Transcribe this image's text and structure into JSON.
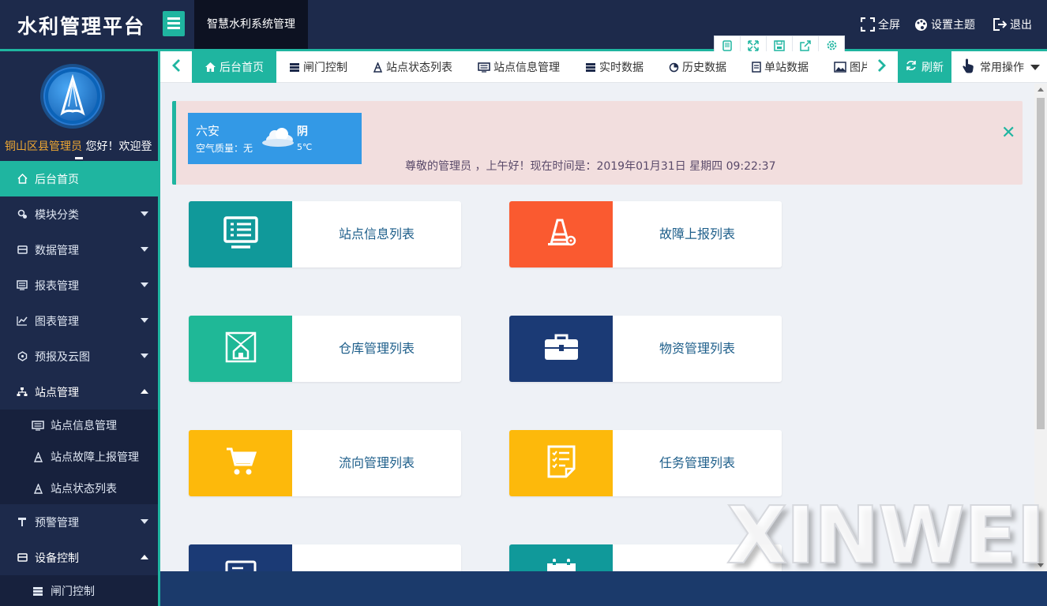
{
  "header": {
    "logo": "水利管理平台",
    "system_tab": "智慧水利系统管理",
    "fullscreen": "全屏",
    "theme": "设置主题",
    "logout": "退出"
  },
  "sidebar": {
    "user": "铜山区县管理员",
    "welcome": " 您好！欢迎登",
    "items": [
      {
        "label": "后台首页",
        "icon": "home-icon"
      },
      {
        "label": "模块分类",
        "icon": "module-icon"
      },
      {
        "label": "数据管理",
        "icon": "database-icon"
      },
      {
        "label": "报表管理",
        "icon": "report-icon"
      },
      {
        "label": "图表管理",
        "icon": "line-chart-icon"
      },
      {
        "label": "预报及云图",
        "icon": "cloud-icon"
      },
      {
        "label": "站点管理",
        "icon": "sitemap-icon"
      },
      {
        "label": "预警管理",
        "icon": "alarm-icon"
      },
      {
        "label": "设备控制",
        "icon": "device-icon"
      }
    ],
    "site_sub": [
      "站点信息管理",
      "站点故障上报管理",
      "站点状态列表"
    ],
    "device_sub": [
      "闸门控制"
    ]
  },
  "tabs": {
    "items": [
      "后台首页",
      "闸门控制",
      "站点状态列表",
      "站点信息管理",
      "实时数据",
      "历史数据",
      "单站数据",
      "图片管理"
    ],
    "refresh": "刷新",
    "common_ops": "常用操作"
  },
  "weather": {
    "city": "六安",
    "air_quality": "空气质量：无",
    "condition": "阴",
    "temperature": "5℃"
  },
  "notice": {
    "message": "尊敬的管理员 ，上午好！现在时间是：2019年01月31日 星期四 09:22:37",
    "close": "✕"
  },
  "cards": [
    {
      "label": "站点信息列表",
      "color": "#10999a",
      "icon": "monitor-list-icon"
    },
    {
      "label": "故障上报列表",
      "color": "#fa5a30",
      "icon": "cone-gear-icon"
    },
    {
      "label": "仓库管理列表",
      "color": "#1fb897",
      "icon": "warehouse-icon"
    },
    {
      "label": "物资管理列表",
      "color": "#1b3a75",
      "icon": "toolbox-icon"
    },
    {
      "label": "流向管理列表",
      "color": "#fdb90b",
      "icon": "cart-icon"
    },
    {
      "label": "任务管理列表",
      "color": "#fdb90b",
      "icon": "task-list-icon"
    },
    {
      "label": "",
      "color": "#1b3a75",
      "icon": "card-icon"
    },
    {
      "label": "",
      "color": "#10999a",
      "icon": "calendar-icon"
    }
  ],
  "watermark": "XINWEI",
  "colors": {
    "header_bg": "#1d2a4b",
    "accent": "#1fb5a0",
    "footer_bg": "#1b3a6b"
  }
}
